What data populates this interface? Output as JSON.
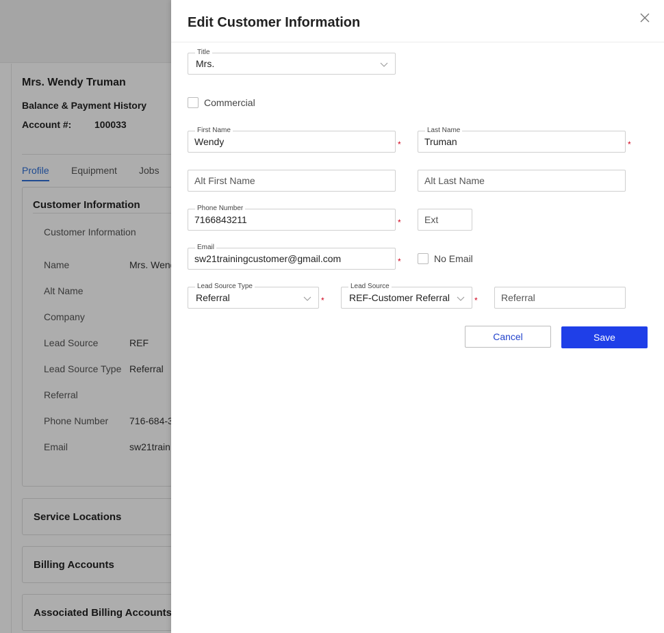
{
  "background": {
    "customer_name": "Mrs. Wendy Truman",
    "balance_link": "Balance & Payment History",
    "account_label": "Account #:",
    "account_number": "100033",
    "tabs": [
      {
        "label": "Profile",
        "active": true
      },
      {
        "label": "Equipment",
        "active": false
      },
      {
        "label": "Jobs",
        "active": false
      }
    ],
    "card_title": "Customer Information",
    "card_subtitle": "Customer Information",
    "rows": [
      {
        "label": "Name",
        "value": "Mrs. Wend"
      },
      {
        "label": "Alt Name",
        "value": ""
      },
      {
        "label": "Company",
        "value": ""
      },
      {
        "label": "Lead Source",
        "value": "REF"
      },
      {
        "label": "Lead Source Type",
        "value": "Referral"
      },
      {
        "label": "Referral",
        "value": ""
      },
      {
        "label": "Phone Number",
        "value": "716-684-3"
      },
      {
        "label": "Email",
        "value": "sw21train"
      }
    ],
    "sections": [
      "Service Locations",
      "Billing Accounts",
      "Associated Billing Accounts"
    ]
  },
  "drawer": {
    "title": "Edit Customer Information",
    "title_field": {
      "label": "Title",
      "value": "Mrs."
    },
    "commercial_label": "Commercial",
    "first_name": {
      "label": "First Name",
      "value": "Wendy"
    },
    "last_name": {
      "label": "Last Name",
      "value": "Truman"
    },
    "alt_first_name": {
      "placeholder": "Alt First Name"
    },
    "alt_last_name": {
      "placeholder": "Alt Last Name"
    },
    "phone": {
      "label": "Phone Number",
      "value": "7166843211"
    },
    "ext": {
      "placeholder": "Ext"
    },
    "email": {
      "label": "Email",
      "value": "sw21trainingcustomer@gmail.com"
    },
    "no_email_label": "No Email",
    "lead_source_type": {
      "label": "Lead Source Type",
      "value": "Referral"
    },
    "lead_source": {
      "label": "Lead Source",
      "value": "REF-Customer Referral"
    },
    "referral": {
      "placeholder": "Referral"
    },
    "required_mark": "*",
    "cancel_label": "Cancel",
    "save_label": "Save"
  },
  "colors": {
    "primary": "#1f3fe8",
    "link": "#2f6fd6",
    "required": "#d0021b"
  }
}
